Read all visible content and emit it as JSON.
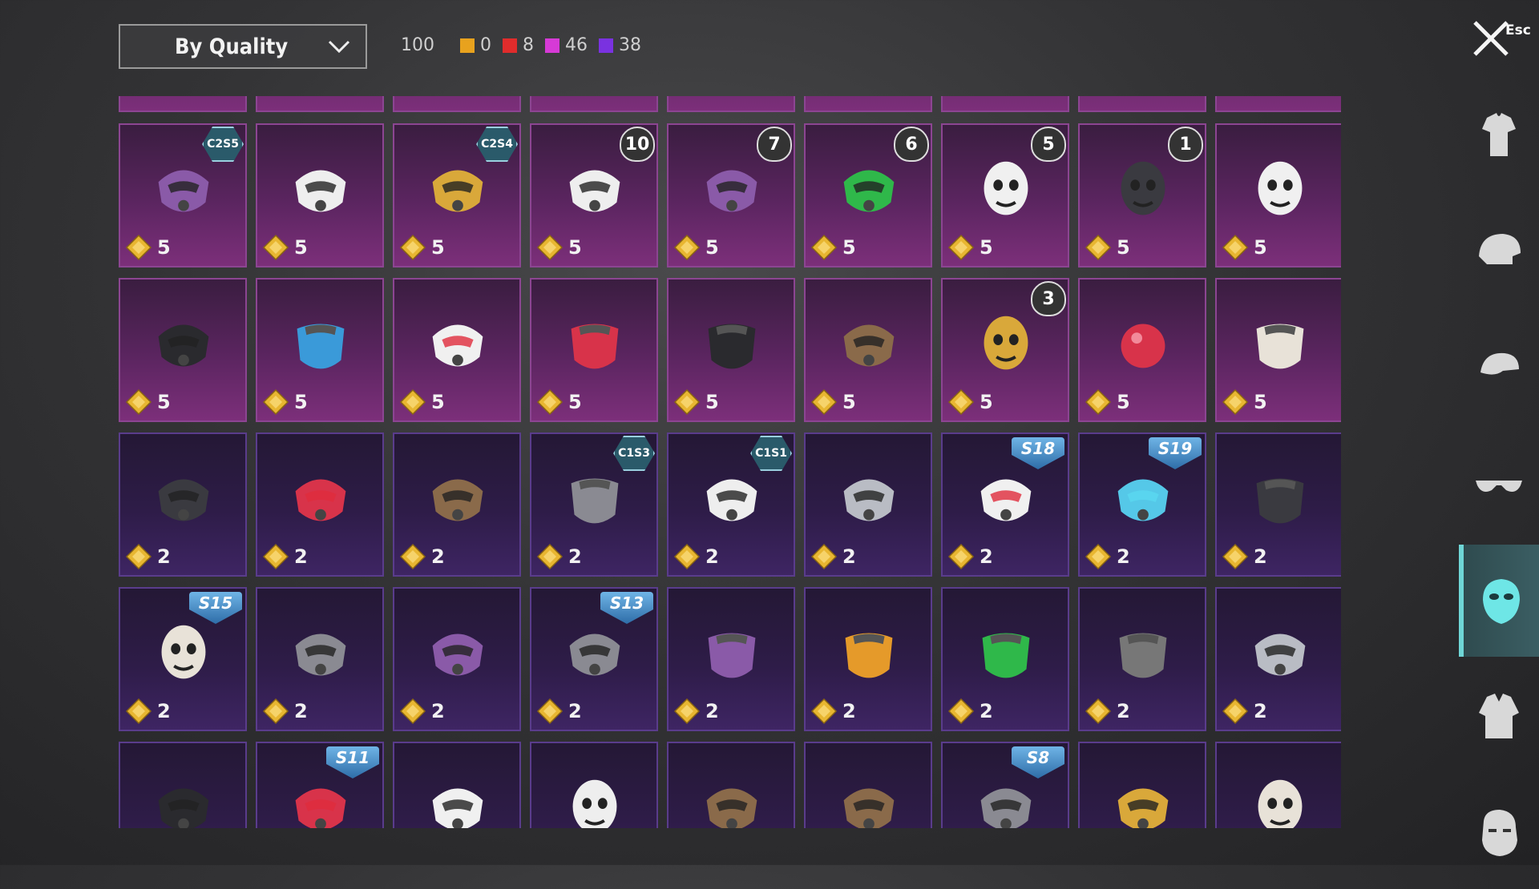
{
  "header": {
    "sort_label": "By Quality",
    "total": "100",
    "quality_counts": [
      {
        "color": "#e8a21e",
        "count": "0"
      },
      {
        "color": "#e02c2c",
        "count": "8"
      },
      {
        "color": "#d63ad6",
        "count": "46"
      },
      {
        "color": "#7a32e0",
        "count": "38"
      }
    ],
    "close_label": "Esc"
  },
  "items": [
    {
      "icon": "gasmask-purple-icon",
      "price": "5",
      "badge": "C2S5",
      "badge_type": "hex",
      "tier": "purple"
    },
    {
      "icon": "white-facemask-icon",
      "price": "5",
      "badge": "",
      "badge_type": "",
      "tier": "purple"
    },
    {
      "icon": "gold-gasmask-icon",
      "price": "5",
      "badge": "C2S4",
      "badge_type": "hex",
      "tier": "purple"
    },
    {
      "icon": "white-respirator-icon",
      "price": "5",
      "badge": "10",
      "badge_type": "shield",
      "tier": "purple"
    },
    {
      "icon": "gold-purple-mask-icon",
      "price": "5",
      "badge": "7",
      "badge_type": "shield",
      "tier": "purple"
    },
    {
      "icon": "green-tiki-mask-icon",
      "price": "5",
      "badge": "6",
      "badge_type": "shield",
      "tier": "purple"
    },
    {
      "icon": "clown-mask-icon",
      "price": "5",
      "badge": "5",
      "badge_type": "shield",
      "tier": "purple"
    },
    {
      "icon": "dark-skull-mask-icon",
      "price": "5",
      "badge": "1",
      "badge_type": "shield",
      "tier": "purple"
    },
    {
      "icon": "jester-mask-icon",
      "price": "5",
      "badge": "",
      "badge_type": "",
      "tier": "purple"
    },
    {
      "icon": "black-facemask-icon",
      "price": "5",
      "badge": "",
      "badge_type": "",
      "tier": "purple"
    },
    {
      "icon": "blue-bandana-icon",
      "price": "5",
      "badge": "",
      "badge_type": "",
      "tier": "purple"
    },
    {
      "icon": "heart-mask-icon",
      "price": "5",
      "badge": "",
      "badge_type": "",
      "tier": "purple"
    },
    {
      "icon": "red-bandana-icon",
      "price": "5",
      "badge": "",
      "badge_type": "",
      "tier": "purple"
    },
    {
      "icon": "black-bandana-icon",
      "price": "5",
      "badge": "",
      "badge_type": "",
      "tier": "purple"
    },
    {
      "icon": "plague-mask-icon",
      "price": "5",
      "badge": "",
      "badge_type": "",
      "tier": "purple"
    },
    {
      "icon": "gold-skull-mask-icon",
      "price": "5",
      "badge": "3",
      "badge_type": "shield",
      "tier": "purple"
    },
    {
      "icon": "red-nose-icon",
      "price": "5",
      "badge": "",
      "badge_type": "",
      "tier": "purple"
    },
    {
      "icon": "skull-scarf-icon",
      "price": "5",
      "badge": "",
      "badge_type": "",
      "tier": "purple"
    },
    {
      "icon": "dark-halfmask-icon",
      "price": "2",
      "badge": "",
      "badge_type": "",
      "tier": "blue"
    },
    {
      "icon": "red-eye-visor-icon",
      "price": "2",
      "badge": "",
      "badge_type": "",
      "tier": "blue"
    },
    {
      "icon": "mammoth-mask-icon",
      "price": "2",
      "badge": "",
      "badge_type": "",
      "tier": "blue"
    },
    {
      "icon": "cactus-bandana-icon",
      "price": "2",
      "badge": "C1S3",
      "badge_type": "hex",
      "tier": "blue"
    },
    {
      "icon": "blue-white-mask-icon",
      "price": "2",
      "badge": "C1S1",
      "badge_type": "hex",
      "tier": "blue"
    },
    {
      "icon": "silver-halfmask-icon",
      "price": "2",
      "badge": "",
      "badge_type": "",
      "tier": "blue"
    },
    {
      "icon": "heartbeat-mask-icon",
      "price": "2",
      "badge": "S18",
      "badge_type": "season",
      "tier": "blue"
    },
    {
      "icon": "cyber-visor-icon",
      "price": "2",
      "badge": "S19",
      "badge_type": "season",
      "tier": "blue"
    },
    {
      "icon": "dark-scarf-icon",
      "price": "2",
      "badge": "",
      "badge_type": "",
      "tier": "blue"
    },
    {
      "icon": "horned-skull-icon",
      "price": "2",
      "badge": "S15",
      "badge_type": "season",
      "tier": "blue"
    },
    {
      "icon": "masquerade-mask-icon",
      "price": "2",
      "badge": "",
      "badge_type": "",
      "tier": "blue"
    },
    {
      "icon": "purple-goggle-mask-icon",
      "price": "2",
      "badge": "",
      "badge_type": "",
      "tier": "blue"
    },
    {
      "icon": "military-gasmask-icon",
      "price": "2",
      "badge": "S13",
      "badge_type": "season",
      "tier": "blue"
    },
    {
      "icon": "purple-bandana-icon",
      "price": "2",
      "badge": "",
      "badge_type": "",
      "tier": "blue"
    },
    {
      "icon": "orange-bandana-icon",
      "price": "2",
      "badge": "",
      "badge_type": "",
      "tier": "blue"
    },
    {
      "icon": "green-bandana-icon",
      "price": "2",
      "badge": "",
      "badge_type": "",
      "tier": "blue"
    },
    {
      "icon": "grey-bandana-icon",
      "price": "2",
      "badge": "",
      "badge_type": "",
      "tier": "blue"
    },
    {
      "icon": "silver-respirator-icon",
      "price": "2",
      "badge": "",
      "badge_type": "",
      "tier": "blue"
    },
    {
      "icon": "black-halfmask-icon",
      "price": "",
      "badge": "",
      "badge_type": "",
      "tier": "blue"
    },
    {
      "icon": "red-black-mask-icon",
      "price": "",
      "badge": "S11",
      "badge_type": "season",
      "tier": "blue"
    },
    {
      "icon": "mummy-wrap-icon",
      "price": "",
      "badge": "",
      "badge_type": "",
      "tier": "blue"
    },
    {
      "icon": "white-clown-icon",
      "price": "",
      "badge": "",
      "badge_type": "",
      "tier": "blue"
    },
    {
      "icon": "rock-mask-icon",
      "price": "",
      "badge": "",
      "badge_type": "",
      "tier": "blue"
    },
    {
      "icon": "hair-mask-icon",
      "price": "",
      "badge": "",
      "badge_type": "",
      "tier": "blue"
    },
    {
      "icon": "hooded-mask-icon",
      "price": "",
      "badge": "S8",
      "badge_type": "season",
      "tier": "blue"
    },
    {
      "icon": "gold-cloth-mask-icon",
      "price": "",
      "badge": "",
      "badge_type": "",
      "tier": "blue"
    },
    {
      "icon": "panda-skull-icon",
      "price": "",
      "badge": "",
      "badge_type": "",
      "tier": "blue"
    }
  ],
  "sidebar": [
    {
      "name": "outfit-tab",
      "icon": "shirt-icon"
    },
    {
      "name": "hat-tab",
      "icon": "helmet-icon"
    },
    {
      "name": "cap-tab",
      "icon": "cap-icon"
    },
    {
      "name": "glasses-tab",
      "icon": "glasses-icon"
    },
    {
      "name": "mask-tab",
      "icon": "mask-icon",
      "active": true
    },
    {
      "name": "jacket-tab",
      "icon": "jacket-icon"
    },
    {
      "name": "face-tab",
      "icon": "face-icon"
    }
  ],
  "colors": {
    "active_tab": "#6fd6d6",
    "purple_tier": "#7c2f7a",
    "blue_tier": "#3e2563",
    "coin": "#e8b631"
  }
}
